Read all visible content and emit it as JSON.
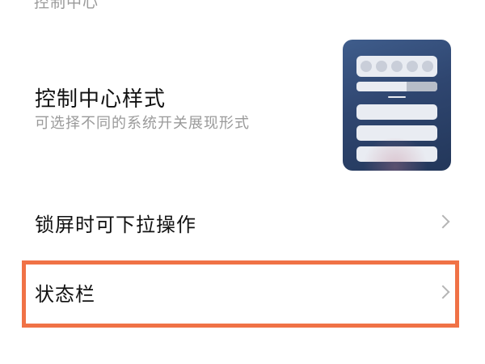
{
  "section": {
    "label": "控制中心"
  },
  "control_center_style": {
    "title": "控制中心样式",
    "subtitle": "可选择不同的系统开关展现形式",
    "preview_icon": "control-center-preview-thumbnail"
  },
  "settings": [
    {
      "label": "锁屏时可下拉操作",
      "icon": "chevron-right-icon"
    },
    {
      "label": "状态栏",
      "icon": "chevron-right-icon",
      "highlighted": true
    }
  ],
  "colors": {
    "highlight_border": "#f07246",
    "preview_background": "#2f4670",
    "title_text": "#111111",
    "secondary_text": "#9a9a9a",
    "chevron": "#b5b5b5"
  }
}
